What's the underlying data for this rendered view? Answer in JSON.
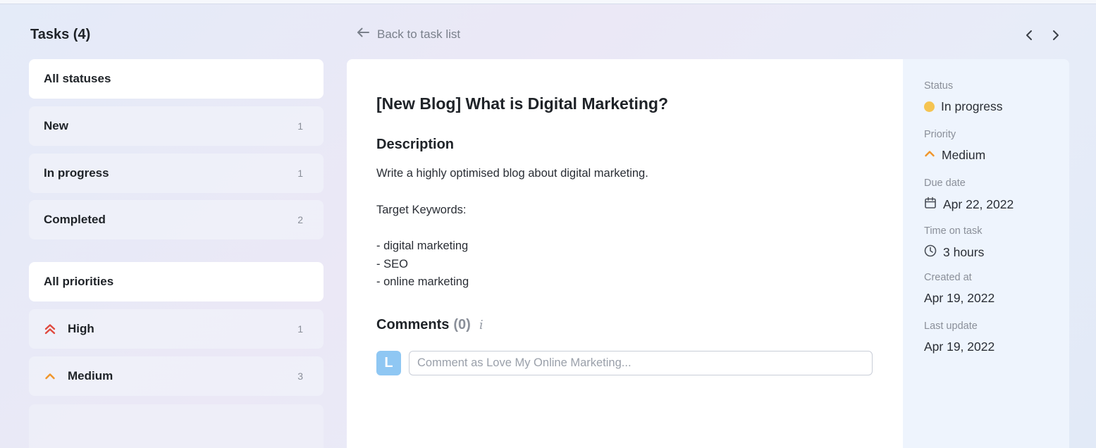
{
  "header": {
    "tasks_title": "Tasks (4)",
    "back_label": "Back to task list"
  },
  "filters": {
    "statuses": [
      {
        "label": "All statuses",
        "count": "",
        "active": true
      },
      {
        "label": "New",
        "count": "1",
        "active": false
      },
      {
        "label": "In progress",
        "count": "1",
        "active": false
      },
      {
        "label": "Completed",
        "count": "2",
        "active": false
      }
    ],
    "priorities": [
      {
        "label": "All priorities",
        "count": "",
        "active": true,
        "icon": ""
      },
      {
        "label": "High",
        "count": "1",
        "active": false,
        "icon": "double-chevron-up-icon"
      },
      {
        "label": "Medium",
        "count": "3",
        "active": false,
        "icon": "chevron-up-icon"
      }
    ]
  },
  "task": {
    "title": "[New Blog] What is Digital Marketing?",
    "description_heading": "Description",
    "description_lines": [
      "Write a highly optimised blog about digital marketing.",
      "Target Keywords:",
      "- digital marketing",
      "- SEO",
      "- online marketing"
    ]
  },
  "comments": {
    "heading": "Comments",
    "count": "(0)",
    "info_glyph": "i",
    "avatar_letter": "L",
    "placeholder": "Comment as Love My Online Marketing..."
  },
  "meta": {
    "status_label": "Status",
    "status_value": "In progress",
    "priority_label": "Priority",
    "priority_value": "Medium",
    "due_label": "Due date",
    "due_value": "Apr 22, 2022",
    "time_label": "Time on task",
    "time_value": "3 hours",
    "created_label": "Created at",
    "created_value": "Apr 19, 2022",
    "updated_label": "Last update",
    "updated_value": "Apr 19, 2022"
  },
  "colors": {
    "high_priority": "#e04a3f",
    "medium_priority": "#f0952a",
    "status_in_progress": "#f5c451",
    "avatar": "#8fc7f3"
  }
}
